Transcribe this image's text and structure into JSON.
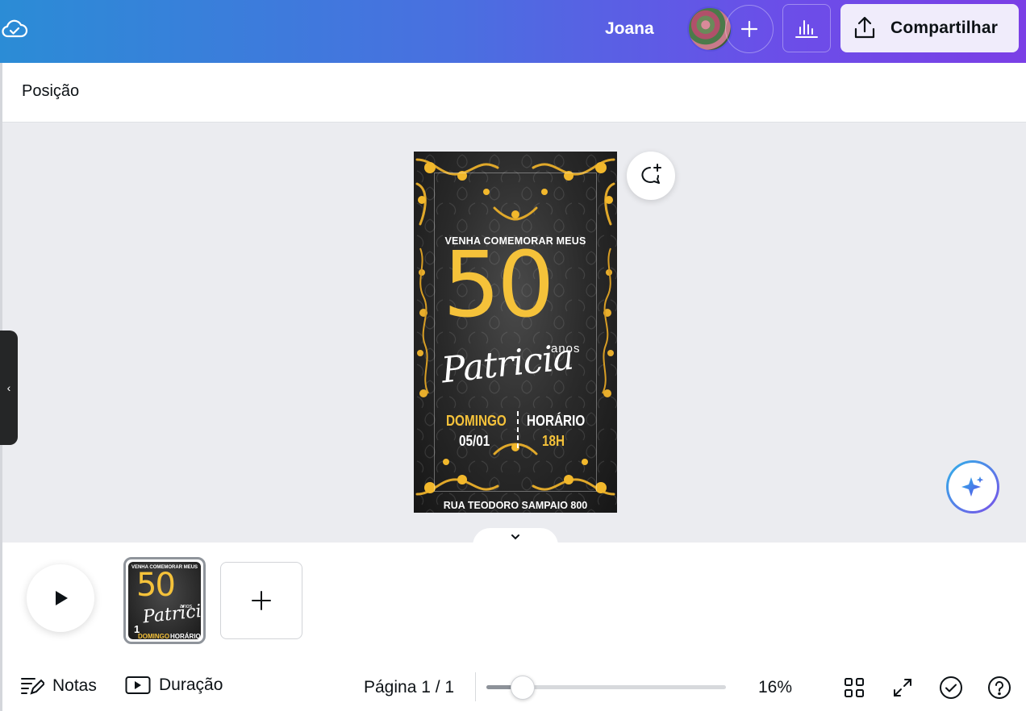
{
  "header": {
    "user_name": "Joana",
    "share_label": "Compartilhar",
    "icons": [
      "cloud-check-icon",
      "plus-icon",
      "bar-chart-icon",
      "share-upload-icon"
    ]
  },
  "context_toolbar": {
    "position_label": "Posição"
  },
  "design": {
    "venha": "VENHA COMEMORAR MEUS",
    "number": "50",
    "anos": "anos",
    "name": "Patricia",
    "day_label": "DOMINGO",
    "date": "05/01",
    "time_label": "HORÁRIO",
    "time": "18H",
    "address": "RUA TEODORO SAMPAIO 800",
    "colors": {
      "gold": "#f5c23a",
      "background": "#1e1e1e",
      "text": "#ffffff"
    }
  },
  "pages": {
    "thumbnail": {
      "page_number": "1",
      "venha": "VENHA COMEMORAR MEUS",
      "number": "50",
      "anos": "anos",
      "name": "Patricia",
      "day_label": "DOMINGO",
      "time_label": "HORÁRIO"
    }
  },
  "footer": {
    "notes_label": "Notas",
    "duration_label": "Duração",
    "page_indicator": "Página 1 / 1",
    "zoom_level": "16%",
    "zoom_fraction": 0.15
  },
  "colors": {
    "accent_gradient_start": "#2b8cd6",
    "accent_gradient_end": "#7b3fe6",
    "canvas_bg": "#ebecf0"
  }
}
